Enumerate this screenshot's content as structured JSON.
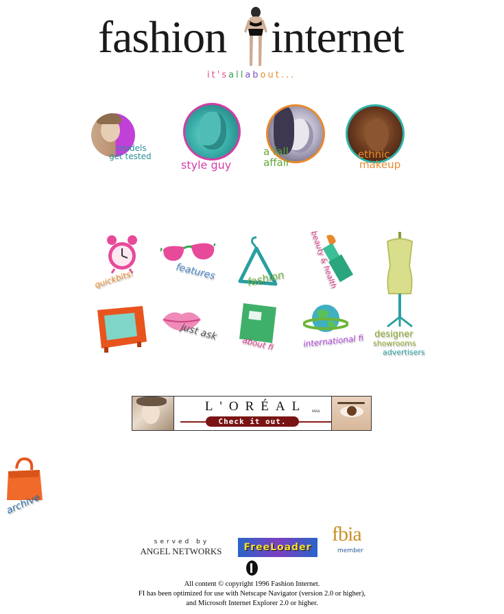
{
  "header": {
    "logo_left": "fashion",
    "logo_right": "internet",
    "tagline": [
      {
        "t": "i",
        "c": "#e24a8a"
      },
      {
        "t": "t",
        "c": "#e24a8a"
      },
      {
        "t": "'",
        "c": "#e24a8a"
      },
      {
        "t": "s",
        "c": "#e24a8a"
      },
      {
        "t": "a",
        "c": "#39a04a"
      },
      {
        "t": "l",
        "c": "#39a04a"
      },
      {
        "t": "l",
        "c": "#39a04a"
      },
      {
        "t": "a",
        "c": "#7a4fc0"
      },
      {
        "t": "b",
        "c": "#7a4fc0"
      },
      {
        "t": "o",
        "c": "#e58a2a"
      },
      {
        "t": "u",
        "c": "#e58a2a"
      },
      {
        "t": "t",
        "c": "#e58a2a"
      },
      {
        "t": ".",
        "c": "#e58a2a"
      },
      {
        "t": ".",
        "c": "#e58a2a"
      },
      {
        "t": ".",
        "c": "#e58a2a"
      }
    ]
  },
  "features": {
    "models": {
      "line1": "models",
      "line2": "get tested"
    },
    "style_guy": {
      "label": "style guy"
    },
    "fall_affair": {
      "line1": "a fall",
      "line2": "affair"
    },
    "ethnic_makeup": {
      "line1": "ethnic",
      "line2": "makeup"
    }
  },
  "icons": {
    "quickbits": "quickbits!",
    "features": "features",
    "fashion": "fashion",
    "beauty": "beauty & health",
    "tv": "",
    "just_ask": "just ask",
    "about": "about fi",
    "international": "international fi",
    "designer": "designer",
    "showrooms": "showrooms",
    "advertisers": "advertisers"
  },
  "ad": {
    "brand": "L'ORÉAL",
    "brand_sub": "PARIS",
    "cta": "Check it out."
  },
  "archive": {
    "label": "archive"
  },
  "partners": {
    "served_by": "served by",
    "angel": "ANGEL NETWORKS",
    "freeloader": "FreeLoader",
    "fbia": "fbia",
    "fbia_member": "member"
  },
  "footer": {
    "line1": "All content © copyright 1996 Fashion Internet.",
    "line2": "FI has been optimized for use with Netscape Navigator (version 2.0 or higher),",
    "line3": "and Microsoft Internet Explorer 2.0 or higher."
  },
  "colors": {
    "pink": "#e0358a",
    "teal": "#2a9fa0",
    "green": "#6bb53a",
    "orange": "#e8892e",
    "purple": "#b045d8"
  }
}
